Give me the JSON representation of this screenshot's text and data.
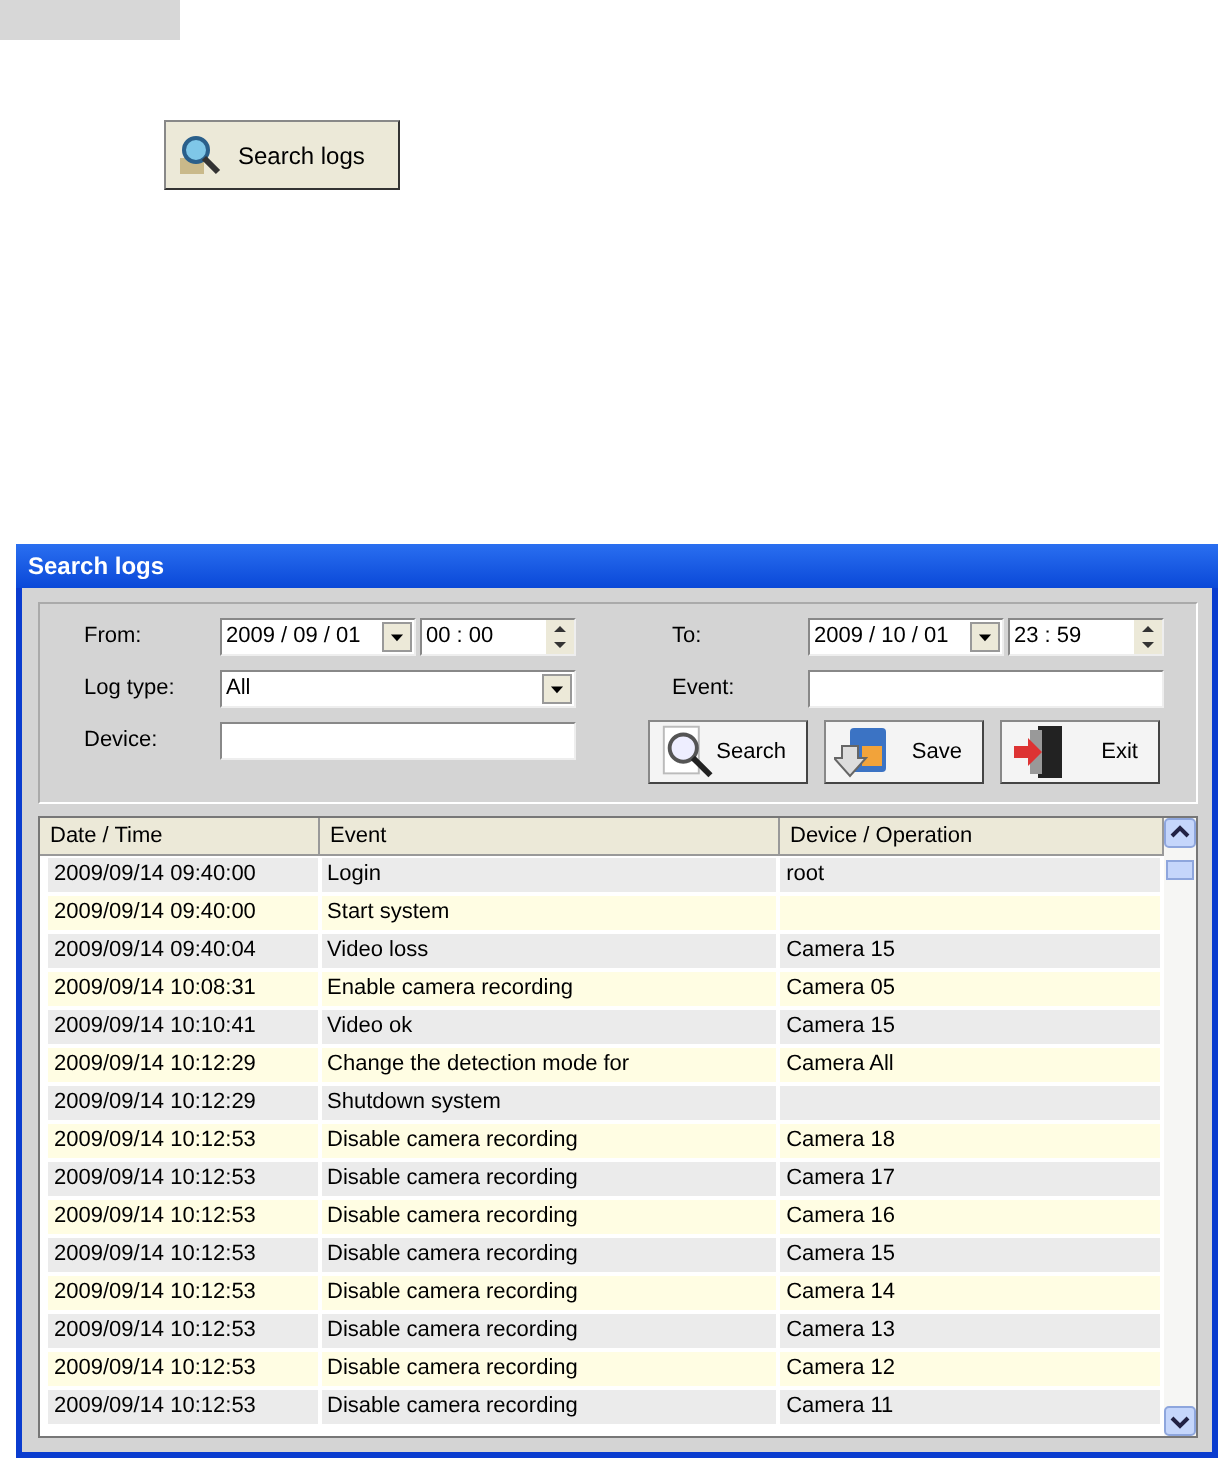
{
  "launcher": {
    "label": "Search logs"
  },
  "window": {
    "title": "Search logs"
  },
  "filters": {
    "from_label": "From:",
    "from_date": "2009 / 09 / 01",
    "from_time": "00  :  00",
    "to_label": "To:",
    "to_date": "2009 / 10 / 01",
    "to_time": "23  :  59",
    "log_type_label": "Log type:",
    "log_type": "All",
    "event_label": "Event:",
    "device_label": "Device:"
  },
  "buttons": [
    {
      "kind": "search",
      "label": "Search"
    },
    {
      "kind": "save",
      "label": "Save"
    },
    {
      "kind": "exit",
      "label": "Exit"
    }
  ],
  "table": {
    "columns": [
      "Date / Time",
      "Event",
      "Device / Operation"
    ],
    "rows": [
      [
        "2009/09/14 09:40:00",
        "Login",
        "root"
      ],
      [
        "2009/09/14 09:40:00",
        "Start system",
        ""
      ],
      [
        "2009/09/14 09:40:04",
        "Video loss",
        "Camera 15"
      ],
      [
        "2009/09/14 10:08:31",
        "Enable camera recording",
        "Camera 05"
      ],
      [
        "2009/09/14 10:10:41",
        "Video ok",
        "Camera 15"
      ],
      [
        "2009/09/14 10:12:29",
        "Change the detection mode for",
        "Camera All"
      ],
      [
        "2009/09/14 10:12:29",
        "Shutdown system",
        ""
      ],
      [
        "2009/09/14 10:12:53",
        "Disable camera recording",
        "Camera 18"
      ],
      [
        "2009/09/14 10:12:53",
        "Disable camera recording",
        "Camera 17"
      ],
      [
        "2009/09/14 10:12:53",
        "Disable camera recording",
        "Camera 16"
      ],
      [
        "2009/09/14 10:12:53",
        "Disable camera recording",
        "Camera 15"
      ],
      [
        "2009/09/14 10:12:53",
        "Disable camera recording",
        "Camera 14"
      ],
      [
        "2009/09/14 10:12:53",
        "Disable camera recording",
        "Camera 13"
      ],
      [
        "2009/09/14 10:12:53",
        "Disable camera recording",
        "Camera 12"
      ],
      [
        "2009/09/14 10:12:53",
        "Disable camera recording",
        "Camera 11"
      ]
    ]
  }
}
